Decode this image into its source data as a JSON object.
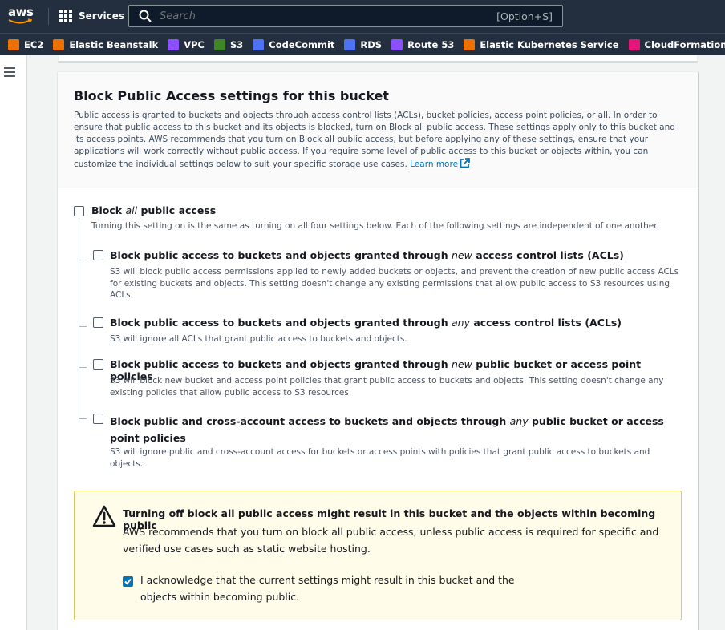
{
  "nav": {
    "logo_text": "aws",
    "services_label": "Services",
    "search_placeholder": "Search",
    "search_shortcut": "[Option+S]"
  },
  "favorites": [
    {
      "label": "EC2",
      "color": "#ed7100",
      "icon": "ec2-icon"
    },
    {
      "label": "Elastic Beanstalk",
      "color": "#ed7100",
      "icon": "elastic-beanstalk-icon"
    },
    {
      "label": "VPC",
      "color": "#8c4fff",
      "icon": "vpc-icon"
    },
    {
      "label": "S3",
      "color": "#3f8624",
      "icon": "s3-icon"
    },
    {
      "label": "CodeCommit",
      "color": "#4d72f3",
      "icon": "codecommit-icon"
    },
    {
      "label": "RDS",
      "color": "#4d72f3",
      "icon": "rds-icon"
    },
    {
      "label": "Route 53",
      "color": "#8c4fff",
      "icon": "route53-icon"
    },
    {
      "label": "Elastic Kubernetes Service",
      "color": "#ed7100",
      "icon": "eks-icon"
    },
    {
      "label": "CloudFormation",
      "color": "#e7157b",
      "icon": "cloudformation-icon"
    }
  ],
  "panel": {
    "title": "Block Public Access settings for this bucket",
    "description": "Public access is granted to buckets and objects through access control lists (ACLs), bucket policies, access point policies, or all. In order to ensure that public access to this bucket and its objects is blocked, turn on Block all public access. These settings apply only to this bucket and its access points. AWS recommends that you turn on Block all public access, but before applying any of these settings, ensure that your applications will work correctly without public access. If you require some level of public access to this bucket or objects within, you can customize the individual settings below to suit your specific storage use cases.",
    "learn_more": "Learn more"
  },
  "block_all": {
    "label_pre": "Block ",
    "label_em": "all",
    "label_post": " public access",
    "desc": "Turning this setting on is the same as turning on all four settings below. Each of the following settings are independent of one another.",
    "checked": false
  },
  "settings": [
    {
      "label_pre": "Block public access to buckets and objects granted through ",
      "label_em": "new",
      "label_post": " access control lists (ACLs)",
      "desc": "S3 will block public access permissions applied to newly added buckets or objects, and prevent the creation of new public access ACLs for existing buckets and objects. This setting doesn't change any existing permissions that allow public access to S3 resources using ACLs.",
      "checked": false
    },
    {
      "label_pre": "Block public access to buckets and objects granted through ",
      "label_em": "any",
      "label_post": " access control lists (ACLs)",
      "desc": "S3 will ignore all ACLs that grant public access to buckets and objects.",
      "checked": false
    },
    {
      "label_pre": "Block public access to buckets and objects granted through ",
      "label_em": "new",
      "label_post": " public bucket or access point policies",
      "desc": "S3 will block new bucket and access point policies that grant public access to buckets and objects. This setting doesn't change any existing policies that allow public access to S3 resources.",
      "checked": false
    },
    {
      "label_pre": "Block public and cross-account access to buckets and objects through ",
      "label_em": "any",
      "label_post": " public bucket or access point policies",
      "desc": "S3 will ignore public and cross-account access for buckets or access points with policies that grant public access to buckets and objects.",
      "checked": false
    }
  ],
  "warning": {
    "title": "Turning off block all public access might result in this bucket and the objects within becoming public",
    "body": "AWS recommends that you turn on block all public access, unless public access is required for specific and verified use cases such as static website hosting.",
    "ack_label": "I acknowledge that the current settings might result in this bucket and the objects within becoming public.",
    "ack_checked": true
  }
}
